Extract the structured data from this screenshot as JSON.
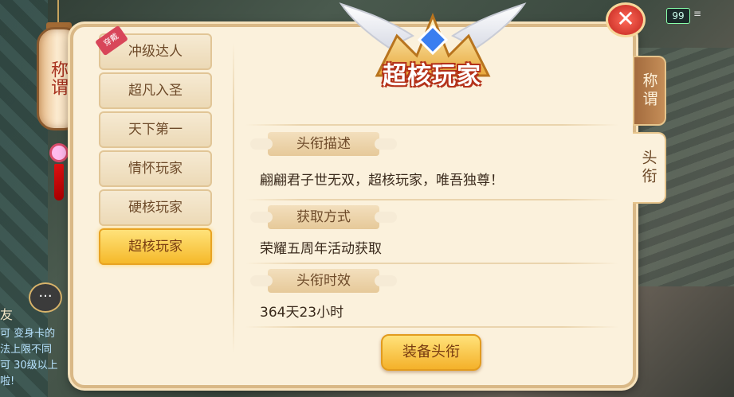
{
  "hud": {
    "level_badge": "99",
    "chat_icon": "···",
    "friend_label": "友",
    "chat_lines": [
      "可 变身卡的",
      "法上限不同",
      "可 30级以上",
      "啦!"
    ]
  },
  "lantern": {
    "label": "称谓"
  },
  "emblem": {
    "title": "超核玩家"
  },
  "close_icon": "✕",
  "titles": {
    "equipped_tag": "穿戴",
    "items": [
      {
        "label": "冲级达人",
        "equipped": true
      },
      {
        "label": "超凡入圣"
      },
      {
        "label": "天下第一"
      },
      {
        "label": "情怀玩家"
      },
      {
        "label": "硬核玩家"
      },
      {
        "label": "超核玩家",
        "selected": true
      }
    ]
  },
  "side_tabs": {
    "title_tab": "称谓",
    "rank_tab": "头衔"
  },
  "detail": {
    "description_header": "头衔描述",
    "description_text": "翩翩君子世无双，超核玩家，唯吾独尊！",
    "source_header": "获取方式",
    "source_text": "荣耀五周年活动获取",
    "duration_header": "头衔时效",
    "duration_text": "364天23小时"
  },
  "equip_button": "装备头衔",
  "colors": {
    "panel_bg": "#fbf1dc",
    "selected_gold": "#f5b92a",
    "emblem_outline": "#b4321a",
    "close_red": "#c0241c"
  }
}
